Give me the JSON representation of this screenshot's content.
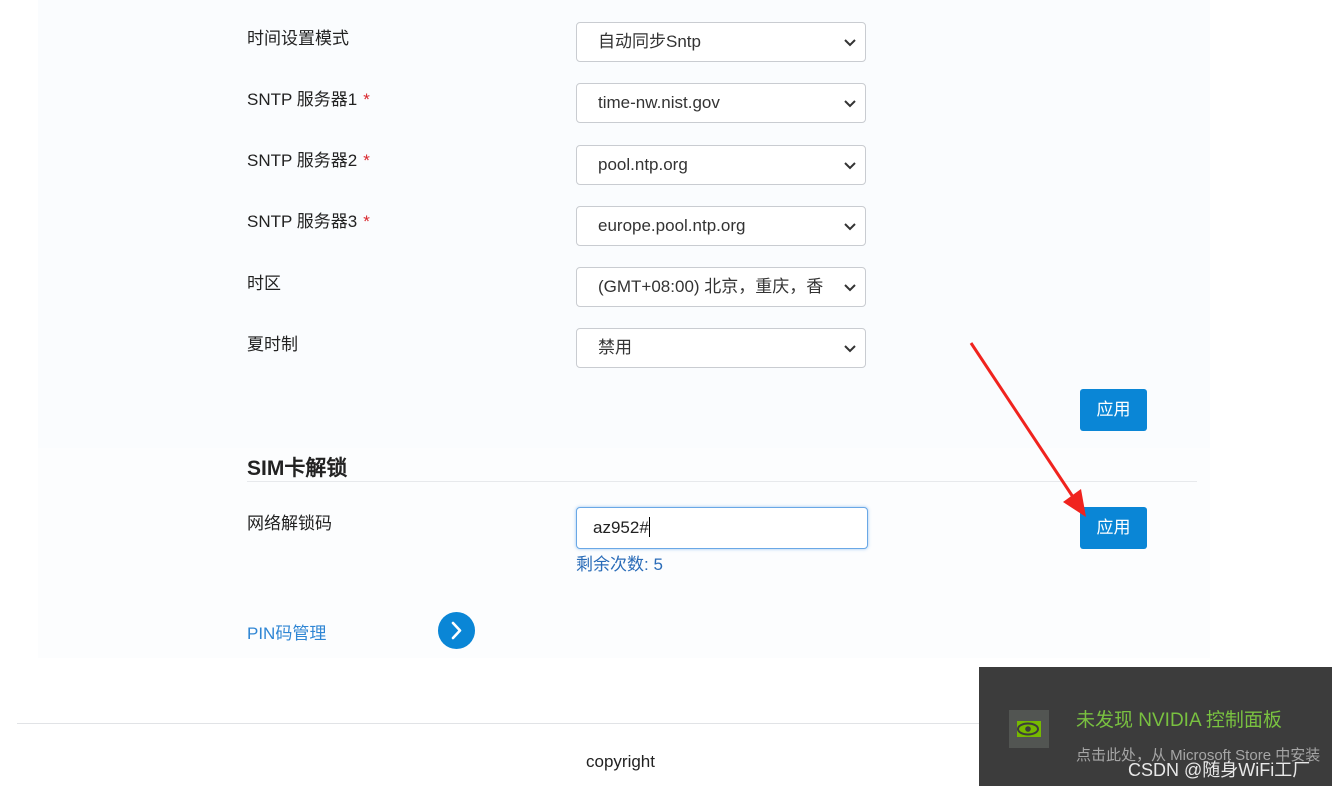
{
  "time_settings": {
    "rows": [
      {
        "label": "时间设置模式",
        "required": false,
        "value": "自动同步Sntp"
      },
      {
        "label": "SNTP 服务器1",
        "required": true,
        "value": "time-nw.nist.gov"
      },
      {
        "label": "SNTP 服务器2",
        "required": true,
        "value": "pool.ntp.org"
      },
      {
        "label": "SNTP 服务器3",
        "required": true,
        "value": "europe.pool.ntp.org"
      },
      {
        "label": "时区",
        "required": false,
        "value": "(GMT+08:00) 北京，重庆，香"
      },
      {
        "label": "夏时制",
        "required": false,
        "value": "禁用"
      }
    ],
    "required_mark": "*",
    "apply_label": "应用"
  },
  "sim_unlock": {
    "title": "SIM卡解锁",
    "field_label": "网络解锁码",
    "field_value": "az952#",
    "remaining_text": "剩余次数: 5",
    "apply_label": "应用"
  },
  "pin": {
    "link_label": "PIN码管理"
  },
  "footer": {
    "copyright": "copyright"
  },
  "notification": {
    "title": "未发现 NVIDIA 控制面板",
    "subtitle": "点击此处，从 Microsoft Store 中安装"
  },
  "watermark": "CSDN @随身WiFi工厂",
  "colors": {
    "accent": "#0a86d6",
    "link": "#2f86d4",
    "required": "#d9262c",
    "annotation_arrow": "#f0231e",
    "nvidia_green": "#79c140"
  },
  "icons": {
    "select_chevron": "chevron-down-icon",
    "pin_nav": "chevron-right-icon",
    "nvidia": "nvidia-logo-icon"
  }
}
